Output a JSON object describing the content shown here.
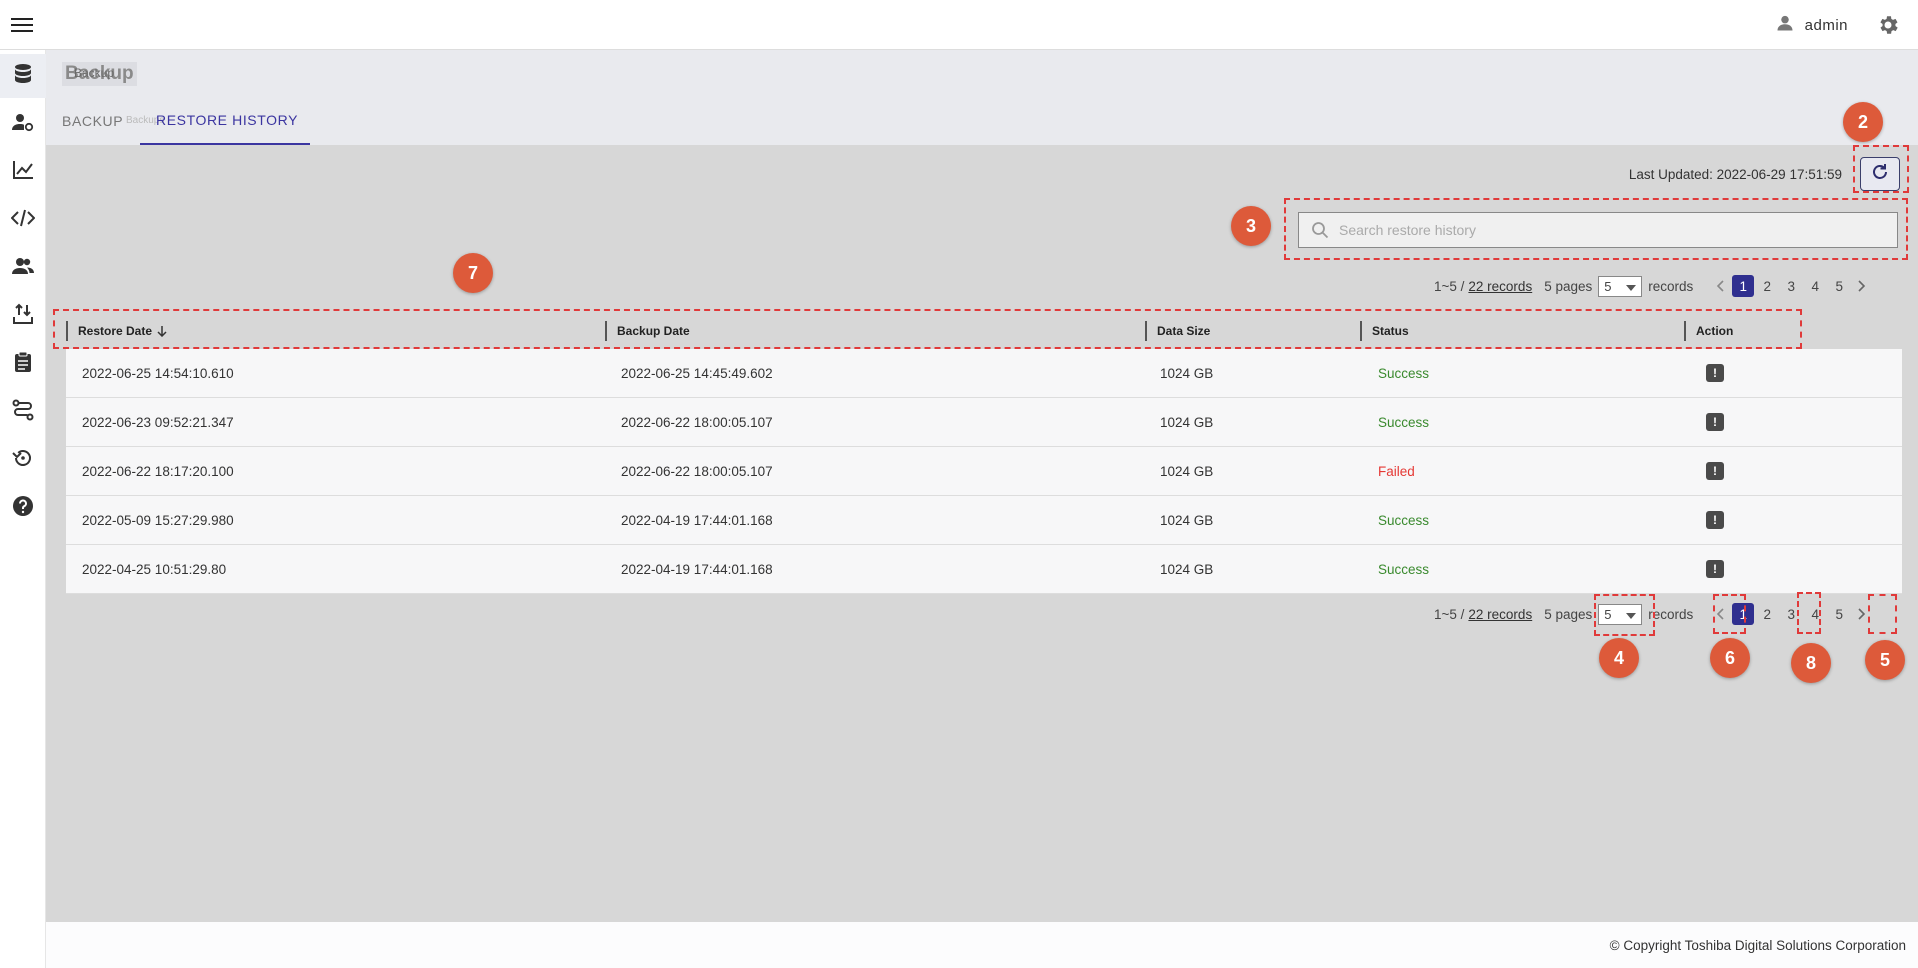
{
  "topbar": {
    "username": "admin"
  },
  "page": {
    "title": "Backup",
    "title_ghost": "Backup",
    "tabs": [
      {
        "label": "BACKUP"
      },
      {
        "label": "RESTORE HISTORY"
      }
    ],
    "tab_ghost": "Backups"
  },
  "toolbar": {
    "last_updated": "Last Updated: 2022-06-29 17:51:59"
  },
  "search": {
    "placeholder": "Search restore history",
    "value": ""
  },
  "pagination": {
    "range": "1~5 /",
    "records_link": "22 records",
    "pages": "5 pages",
    "per_page": "5",
    "records_label": "records",
    "page_numbers": [
      "1",
      "2",
      "3",
      "4",
      "5"
    ],
    "current_page": "1"
  },
  "table": {
    "columns": [
      "Restore Date",
      "Backup Date",
      "Data Size",
      "Status",
      "Action"
    ],
    "rows": [
      {
        "restore_date": "2022-06-25 14:54:10.610",
        "backup_date": "2022-06-25 14:45:49.602",
        "size": "1024 GB",
        "status": "Success"
      },
      {
        "restore_date": "2022-06-23 09:52:21.347",
        "backup_date": "2022-06-22 18:00:05.107",
        "size": "1024 GB",
        "status": "Success"
      },
      {
        "restore_date": "2022-06-22 18:17:20.100",
        "backup_date": "2022-06-22 18:00:05.107",
        "size": "1024 GB",
        "status": "Failed"
      },
      {
        "restore_date": "2022-05-09 15:27:29.980",
        "backup_date": "2022-04-19 17:44:01.168",
        "size": "1024 GB",
        "status": "Success"
      },
      {
        "restore_date": "2022-04-25 10:51:29.80",
        "backup_date": "2022-04-19 17:44:01.168",
        "size": "1024 GB",
        "status": "Success"
      }
    ],
    "action_glyph": "!"
  },
  "callouts": [
    "2",
    "3",
    "7",
    "4",
    "6",
    "8",
    "5"
  ],
  "footer": {
    "copyright": "© Copyright Toshiba Digital Solutions Corporation"
  },
  "icons": {
    "menu": "hamburger-menu-icon",
    "user": "user-icon",
    "settings": "gear-icon",
    "sidebar": [
      "database-icon",
      "user-settings-icon",
      "chart-line-icon",
      "code-icon",
      "users-icon",
      "import-export-icon",
      "clipboard-icon",
      "route-icon",
      "restore-icon",
      "help-icon"
    ]
  },
  "colors": {
    "accent": "#3b35a0",
    "page_active": "#2f2f8f",
    "success": "#3a8a2e",
    "failed": "#e53935",
    "callout": "#dd5a3a",
    "annotation_dash": "#e03a3a"
  }
}
